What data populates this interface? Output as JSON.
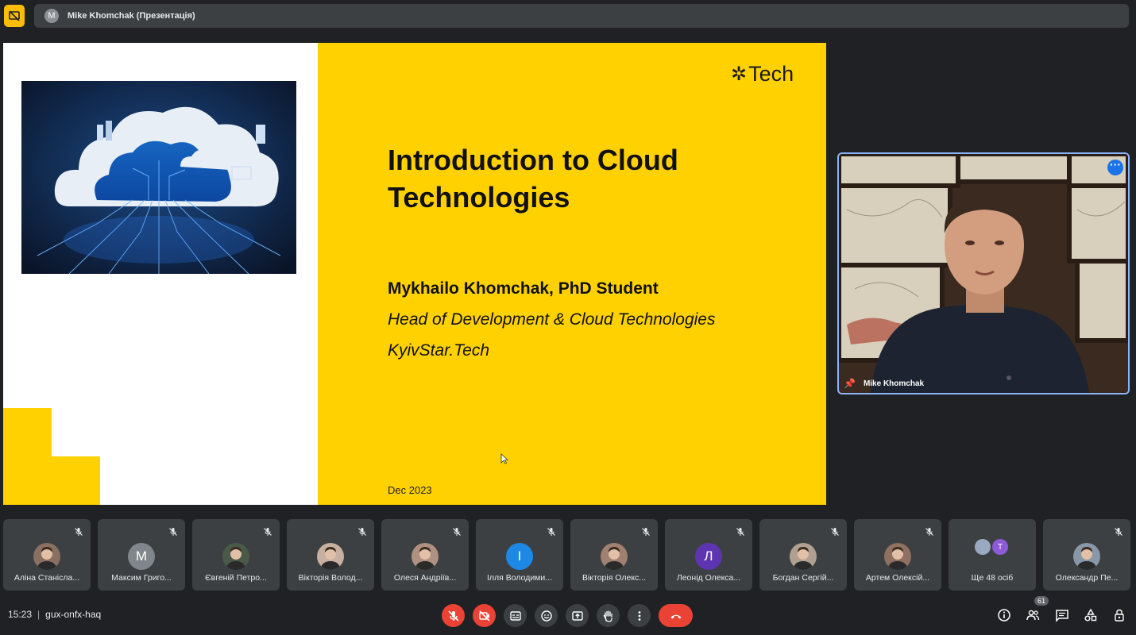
{
  "presentation_bar": {
    "avatar_letter": "M",
    "presenter_label": "Mike Khomchak (Презентація)"
  },
  "slide": {
    "logo_text": "Tech",
    "title": "Introduction to Cloud Technologies",
    "author": "Mykhailo Khomchak, PhD Student",
    "role": "Head of Development & Cloud Technologies",
    "company": "KyivStar.Tech",
    "date": "Dec 2023"
  },
  "speaker": {
    "name": "Mike Khomchak",
    "more_icon": "more-horizontal-icon"
  },
  "participants": [
    {
      "name": "Аліна Станісла...",
      "avatar": "photo",
      "color": "#8a7060"
    },
    {
      "name": "Максим Григо...",
      "avatar": "M",
      "color": "#80868b"
    },
    {
      "name": "Євгеній Петро...",
      "avatar": "photo",
      "color": "#4a5a48"
    },
    {
      "name": "Вікторія Волод...",
      "avatar": "photo",
      "color": "#c8b0a0"
    },
    {
      "name": "Олеся Андріїв...",
      "avatar": "photo",
      "color": "#b09080"
    },
    {
      "name": "Ілля Володими...",
      "avatar": "І",
      "color": "#1e88e5"
    },
    {
      "name": "Вікторія Олекс...",
      "avatar": "photo",
      "color": "#a08070"
    },
    {
      "name": "Леонід Олекса...",
      "avatar": "Л",
      "color": "#5e35b1"
    },
    {
      "name": "Богдан Сергій...",
      "avatar": "photo",
      "color": "#b0a090"
    },
    {
      "name": "Артем Олексій...",
      "avatar": "photo",
      "color": "#907060"
    },
    {
      "name": "Ще 48 осіб",
      "avatar": "group",
      "color": "#3c4043",
      "second_letter": "Т"
    },
    {
      "name": "Олександр Пе...",
      "avatar": "photo",
      "color": "#8898a8"
    }
  ],
  "bottom_bar": {
    "time": "15:23",
    "meeting_code": "gux-onfx-haq",
    "participant_count": "61"
  },
  "colors": {
    "brand_yellow": "#ffd100",
    "end_call_red": "#ea4335",
    "highlight_blue": "#8ab4f8"
  }
}
